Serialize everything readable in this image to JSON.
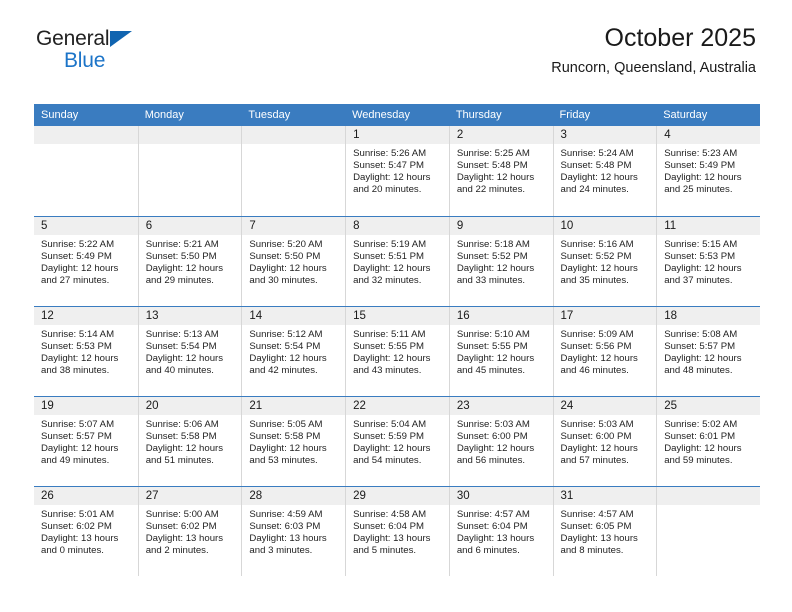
{
  "brand": {
    "line1": "General",
    "line2": "Blue",
    "triangle_color": "#1064b0",
    "blue_text_color": "#1c74c8"
  },
  "header": {
    "title": "October 2025",
    "subtitle": "Runcorn, Queensland, Australia"
  },
  "theme": {
    "header_blue": "#3a7cc0",
    "daynum_band": "#efefef",
    "grid_line": "#d7d7d7"
  },
  "weekday_headers": [
    "Sunday",
    "Monday",
    "Tuesday",
    "Wednesday",
    "Thursday",
    "Friday",
    "Saturday"
  ],
  "labels": {
    "sunrise_prefix": "Sunrise:",
    "sunset_prefix": "Sunset:",
    "daylight_prefix": "Daylight:"
  },
  "weeks": [
    [
      {
        "empty": true
      },
      {
        "empty": true
      },
      {
        "empty": true
      },
      {
        "day": "1",
        "sunrise": "Sunrise: 5:26 AM",
        "sunset": "Sunset: 5:47 PM",
        "daylight": "Daylight: 12 hours and 20 minutes."
      },
      {
        "day": "2",
        "sunrise": "Sunrise: 5:25 AM",
        "sunset": "Sunset: 5:48 PM",
        "daylight": "Daylight: 12 hours and 22 minutes."
      },
      {
        "day": "3",
        "sunrise": "Sunrise: 5:24 AM",
        "sunset": "Sunset: 5:48 PM",
        "daylight": "Daylight: 12 hours and 24 minutes."
      },
      {
        "day": "4",
        "sunrise": "Sunrise: 5:23 AM",
        "sunset": "Sunset: 5:49 PM",
        "daylight": "Daylight: 12 hours and 25 minutes."
      }
    ],
    [
      {
        "day": "5",
        "sunrise": "Sunrise: 5:22 AM",
        "sunset": "Sunset: 5:49 PM",
        "daylight": "Daylight: 12 hours and 27 minutes."
      },
      {
        "day": "6",
        "sunrise": "Sunrise: 5:21 AM",
        "sunset": "Sunset: 5:50 PM",
        "daylight": "Daylight: 12 hours and 29 minutes."
      },
      {
        "day": "7",
        "sunrise": "Sunrise: 5:20 AM",
        "sunset": "Sunset: 5:50 PM",
        "daylight": "Daylight: 12 hours and 30 minutes."
      },
      {
        "day": "8",
        "sunrise": "Sunrise: 5:19 AM",
        "sunset": "Sunset: 5:51 PM",
        "daylight": "Daylight: 12 hours and 32 minutes."
      },
      {
        "day": "9",
        "sunrise": "Sunrise: 5:18 AM",
        "sunset": "Sunset: 5:52 PM",
        "daylight": "Daylight: 12 hours and 33 minutes."
      },
      {
        "day": "10",
        "sunrise": "Sunrise: 5:16 AM",
        "sunset": "Sunset: 5:52 PM",
        "daylight": "Daylight: 12 hours and 35 minutes."
      },
      {
        "day": "11",
        "sunrise": "Sunrise: 5:15 AM",
        "sunset": "Sunset: 5:53 PM",
        "daylight": "Daylight: 12 hours and 37 minutes."
      }
    ],
    [
      {
        "day": "12",
        "sunrise": "Sunrise: 5:14 AM",
        "sunset": "Sunset: 5:53 PM",
        "daylight": "Daylight: 12 hours and 38 minutes."
      },
      {
        "day": "13",
        "sunrise": "Sunrise: 5:13 AM",
        "sunset": "Sunset: 5:54 PM",
        "daylight": "Daylight: 12 hours and 40 minutes."
      },
      {
        "day": "14",
        "sunrise": "Sunrise: 5:12 AM",
        "sunset": "Sunset: 5:54 PM",
        "daylight": "Daylight: 12 hours and 42 minutes."
      },
      {
        "day": "15",
        "sunrise": "Sunrise: 5:11 AM",
        "sunset": "Sunset: 5:55 PM",
        "daylight": "Daylight: 12 hours and 43 minutes."
      },
      {
        "day": "16",
        "sunrise": "Sunrise: 5:10 AM",
        "sunset": "Sunset: 5:55 PM",
        "daylight": "Daylight: 12 hours and 45 minutes."
      },
      {
        "day": "17",
        "sunrise": "Sunrise: 5:09 AM",
        "sunset": "Sunset: 5:56 PM",
        "daylight": "Daylight: 12 hours and 46 minutes."
      },
      {
        "day": "18",
        "sunrise": "Sunrise: 5:08 AM",
        "sunset": "Sunset: 5:57 PM",
        "daylight": "Daylight: 12 hours and 48 minutes."
      }
    ],
    [
      {
        "day": "19",
        "sunrise": "Sunrise: 5:07 AM",
        "sunset": "Sunset: 5:57 PM",
        "daylight": "Daylight: 12 hours and 49 minutes."
      },
      {
        "day": "20",
        "sunrise": "Sunrise: 5:06 AM",
        "sunset": "Sunset: 5:58 PM",
        "daylight": "Daylight: 12 hours and 51 minutes."
      },
      {
        "day": "21",
        "sunrise": "Sunrise: 5:05 AM",
        "sunset": "Sunset: 5:58 PM",
        "daylight": "Daylight: 12 hours and 53 minutes."
      },
      {
        "day": "22",
        "sunrise": "Sunrise: 5:04 AM",
        "sunset": "Sunset: 5:59 PM",
        "daylight": "Daylight: 12 hours and 54 minutes."
      },
      {
        "day": "23",
        "sunrise": "Sunrise: 5:03 AM",
        "sunset": "Sunset: 6:00 PM",
        "daylight": "Daylight: 12 hours and 56 minutes."
      },
      {
        "day": "24",
        "sunrise": "Sunrise: 5:03 AM",
        "sunset": "Sunset: 6:00 PM",
        "daylight": "Daylight: 12 hours and 57 minutes."
      },
      {
        "day": "25",
        "sunrise": "Sunrise: 5:02 AM",
        "sunset": "Sunset: 6:01 PM",
        "daylight": "Daylight: 12 hours and 59 minutes."
      }
    ],
    [
      {
        "day": "26",
        "sunrise": "Sunrise: 5:01 AM",
        "sunset": "Sunset: 6:02 PM",
        "daylight": "Daylight: 13 hours and 0 minutes."
      },
      {
        "day": "27",
        "sunrise": "Sunrise: 5:00 AM",
        "sunset": "Sunset: 6:02 PM",
        "daylight": "Daylight: 13 hours and 2 minutes."
      },
      {
        "day": "28",
        "sunrise": "Sunrise: 4:59 AM",
        "sunset": "Sunset: 6:03 PM",
        "daylight": "Daylight: 13 hours and 3 minutes."
      },
      {
        "day": "29",
        "sunrise": "Sunrise: 4:58 AM",
        "sunset": "Sunset: 6:04 PM",
        "daylight": "Daylight: 13 hours and 5 minutes."
      },
      {
        "day": "30",
        "sunrise": "Sunrise: 4:57 AM",
        "sunset": "Sunset: 6:04 PM",
        "daylight": "Daylight: 13 hours and 6 minutes."
      },
      {
        "day": "31",
        "sunrise": "Sunrise: 4:57 AM",
        "sunset": "Sunset: 6:05 PM",
        "daylight": "Daylight: 13 hours and 8 minutes."
      },
      {
        "empty": true
      }
    ]
  ]
}
